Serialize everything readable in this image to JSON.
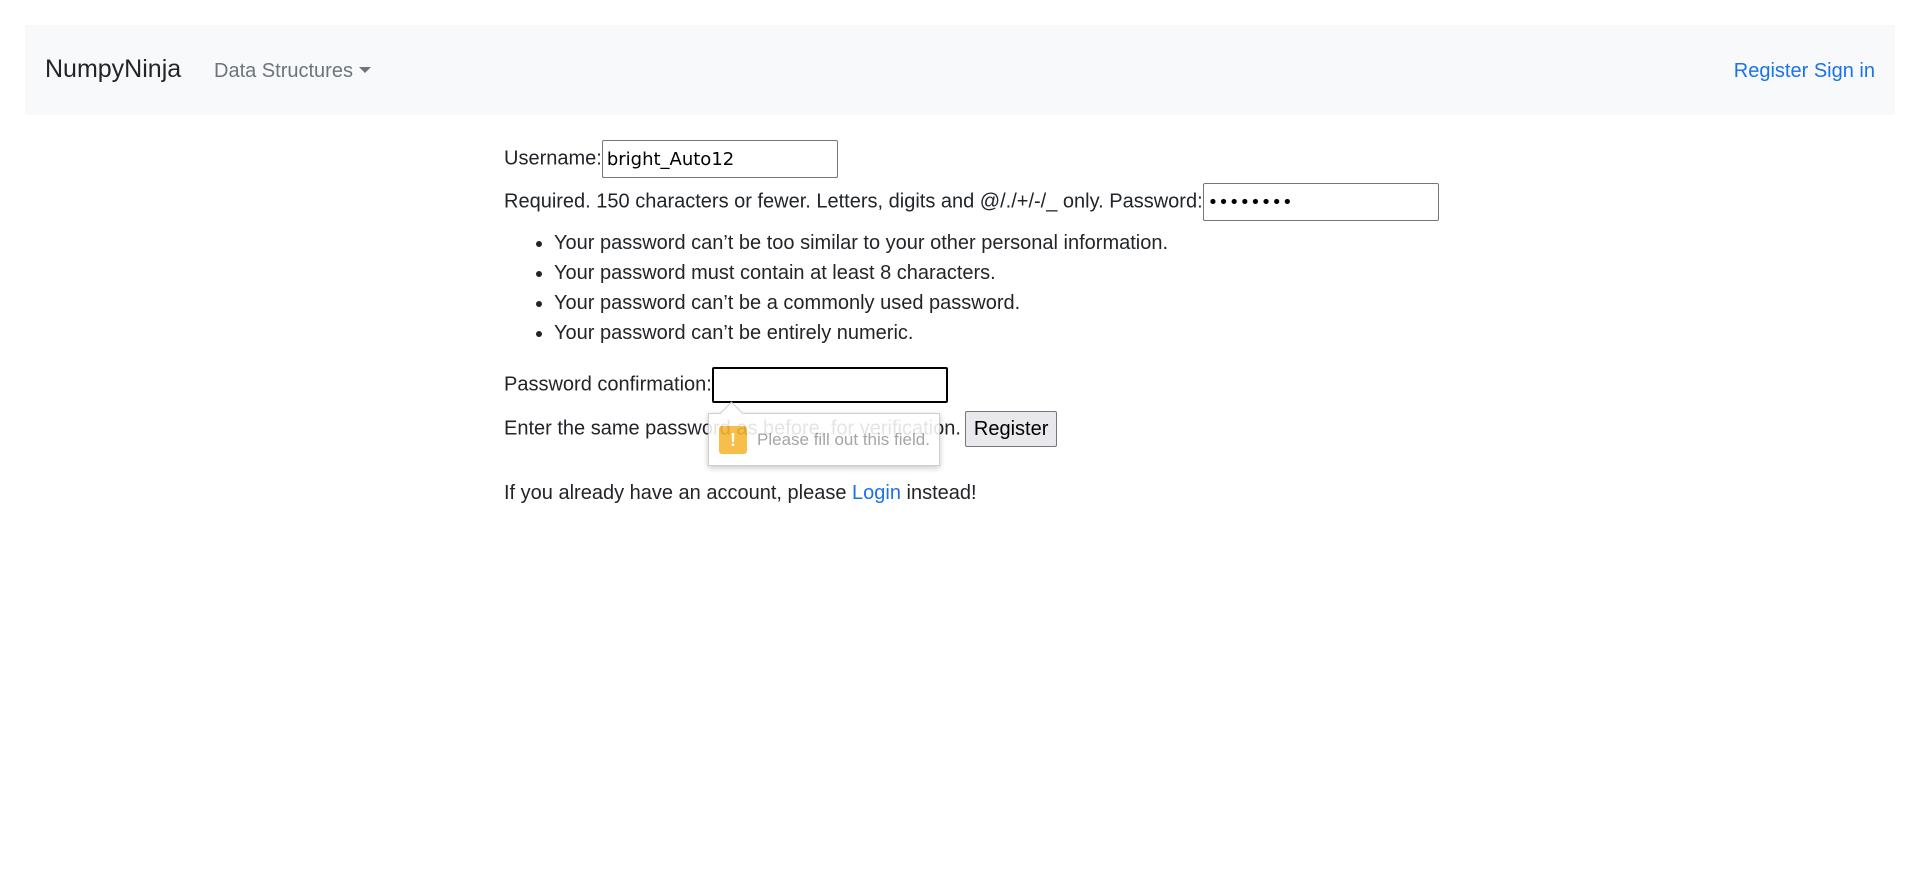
{
  "navbar": {
    "brand": "NumpyNinja",
    "dropdown_label": "Data Structures",
    "register_link": "Register",
    "signin_link": "Sign in"
  },
  "form": {
    "username_label": "Username:",
    "username_value": "bright_Auto12",
    "username_help": "Required. 150 characters or fewer. Letters, digits and @/./+/-/_ only.",
    "password_label": "Password:",
    "password_value": "••••••••",
    "password_rules": [
      "Your password can’t be too similar to your other personal information.",
      "Your password must contain at least 8 characters.",
      "Your password can’t be a commonly used password.",
      "Your password can’t be entirely numeric."
    ],
    "confirm_label": "Password confirmation:",
    "confirm_value": "",
    "confirm_help": "Enter the same password as before, for verification.",
    "register_button": "Register"
  },
  "validation_tooltip": {
    "icon": "warning-icon",
    "message": "Please fill out this field."
  },
  "footer_text": {
    "prefix": "If you already have an account, please",
    "login_link": "Login",
    "suffix": "instead!"
  },
  "colors": {
    "link": "#1a73e8",
    "navbar_bg": "#f8f9fa",
    "warning": "#f7b731"
  }
}
